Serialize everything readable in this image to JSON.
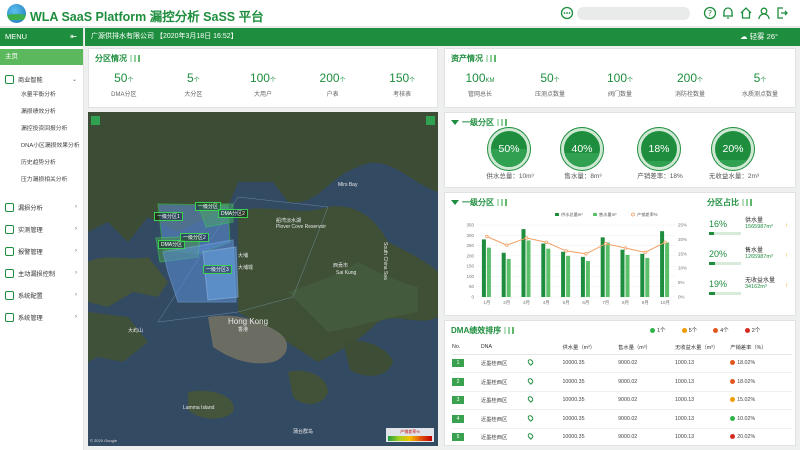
{
  "app": {
    "title": "WLA SaaS Platform 漏控分析 SaSS 平台"
  },
  "sidebar": {
    "menu_label": "MENU",
    "home": "主页",
    "groups": [
      {
        "label": "商业智能",
        "expanded": true,
        "items": [
          "水量平衡分析",
          "漏损绩效分析",
          "漏控投资回报分析",
          "DNA小区漏损效果分析",
          "历史趋势分析",
          "压力漏损相关分析"
        ]
      },
      {
        "label": "漏损分析"
      },
      {
        "label": "实测管理"
      },
      {
        "label": "报警管理"
      },
      {
        "label": "主动漏损控制"
      },
      {
        "label": "系统配置"
      },
      {
        "label": "系统管理"
      }
    ]
  },
  "company_bar": {
    "company": "广源供排水有限公司",
    "datetime": "2020年3月18日 16:52",
    "weather": "轻雾 26°"
  },
  "partition": {
    "title": "分区情况",
    "stats": [
      {
        "value": "50",
        "unit": "个",
        "label": "DMA分区"
      },
      {
        "value": "5",
        "unit": "个",
        "label": "大分区"
      },
      {
        "value": "100",
        "unit": "个",
        "label": "大用户"
      },
      {
        "value": "200",
        "unit": "个",
        "label": "户表"
      },
      {
        "value": "150",
        "unit": "个",
        "label": "考核表"
      }
    ]
  },
  "assets": {
    "title": "资产情况",
    "stats": [
      {
        "value": "100",
        "unit": "KM",
        "label": "管网总长"
      },
      {
        "value": "50",
        "unit": "个",
        "label": "压测点数量"
      },
      {
        "value": "100",
        "unit": "个",
        "label": "阀门数量"
      },
      {
        "value": "200",
        "unit": "个",
        "label": "消防栓数量"
      },
      {
        "value": "5",
        "unit": "个",
        "label": "水质测点数量"
      }
    ]
  },
  "map": {
    "labels": [
      {
        "text": "一级分区1"
      },
      {
        "text": "一级分区"
      },
      {
        "text": "DMA分区"
      },
      {
        "text": "DMA分区2"
      },
      {
        "text": "一级分区2"
      },
      {
        "text": "大埔"
      },
      {
        "text": "一级分区3"
      },
      {
        "text": "大埔墟"
      },
      {
        "text": "Mirs Bay"
      },
      {
        "text": "船湾淡水湖"
      },
      {
        "text": "Plover Cove Reservoir"
      },
      {
        "text": "西贡市"
      },
      {
        "text": "Sai Kung"
      },
      {
        "text": "Hong Kong"
      },
      {
        "text": "香港"
      },
      {
        "text": "South China Sea"
      },
      {
        "text": "Lamma Island"
      },
      {
        "text": "蒲台群岛"
      },
      {
        "text": "大屿山"
      }
    ],
    "legend_title": "产销差率%",
    "copyright": "© 2020 Google"
  },
  "level1": {
    "title": "一级分区",
    "gauges": [
      {
        "percent": 50,
        "label": "50%",
        "caption": "供水总量：10m³"
      },
      {
        "percent": 40,
        "label": "40%",
        "caption": "售水量：8m³"
      },
      {
        "percent": 18,
        "label": "18%",
        "caption": "产销差率：18%"
      },
      {
        "percent": 20,
        "label": "20%",
        "caption": "无收益水量：2m³"
      }
    ]
  },
  "level1_chart": {
    "title": "一级分区",
    "chart_data": {
      "type": "bar",
      "categories": [
        "1月",
        "2月",
        "3月",
        "4月",
        "5月",
        "6月",
        "7月",
        "8月",
        "9月",
        "10月"
      ],
      "legend": [
        "供水总量m³",
        "售水量m³",
        "产销差率%"
      ],
      "series": [
        {
          "name": "供水总量m³",
          "values": [
            280,
            215,
            330,
            260,
            220,
            195,
            290,
            230,
            210,
            320
          ]
        },
        {
          "name": "售水量m³",
          "values": [
            240,
            185,
            275,
            235,
            200,
            175,
            265,
            205,
            190,
            265
          ]
        },
        {
          "name": "产销差率%",
          "values": [
            21,
            18,
            20.5,
            19,
            16,
            15,
            18.5,
            17,
            15.5,
            19
          ]
        }
      ],
      "y_left_ticks": [
        "0",
        "50",
        "100",
        "150",
        "200",
        "250",
        "300",
        "350"
      ],
      "y_right_ticks": [
        "0%",
        "5%",
        "10%",
        "15%",
        "20%",
        "25%"
      ],
      "ylim_left": [
        0,
        350
      ],
      "ylim_right": [
        0,
        25
      ]
    }
  },
  "ratio": {
    "title": "分区占比",
    "items": [
      {
        "percent": "16%",
        "label": "供水量",
        "value": "1565987m³",
        "fill": 16
      },
      {
        "percent": "20%",
        "label": "售水量",
        "value": "1265987m³",
        "fill": 20
      },
      {
        "percent": "19%",
        "label": "无收益水量",
        "value": "34162m³",
        "fill": 19
      }
    ]
  },
  "dma": {
    "title": "DMA绩效排序",
    "legend": [
      {
        "label": "1个",
        "color": "#2fb34a"
      },
      {
        "label": "5个",
        "color": "#f29b00"
      },
      {
        "label": "4个",
        "color": "#e2551f"
      },
      {
        "label": "2个",
        "color": "#d62b1f"
      }
    ],
    "headers": [
      "No.",
      "DNA",
      "",
      "供水量（m³）",
      "售水量（m³）",
      "无收益水量（m³）",
      "产销差率（%）"
    ],
    "rows": [
      {
        "no": "1",
        "dna": "近墨桂西区",
        "supply": "10000.35",
        "sale": "9000.02",
        "loss": "1000.13",
        "rate": "18.02%",
        "color": "#e2551f"
      },
      {
        "no": "2",
        "dna": "近墨桂西区",
        "supply": "10000.35",
        "sale": "9000.02",
        "loss": "1000.13",
        "rate": "18.02%",
        "color": "#e2551f"
      },
      {
        "no": "3",
        "dna": "近墨桂西区",
        "supply": "10000.35",
        "sale": "9000.02",
        "loss": "1000.13",
        "rate": "15.02%",
        "color": "#f29b00"
      },
      {
        "no": "4",
        "dna": "近墨桂西区",
        "supply": "10000.35",
        "sale": "9000.02",
        "loss": "1000.13",
        "rate": "10.02%",
        "color": "#2fb34a"
      },
      {
        "no": "5",
        "dna": "近墨桂西区",
        "supply": "10000.35",
        "sale": "9000.02",
        "loss": "1000.13",
        "rate": "20.02%",
        "color": "#d62b1f"
      }
    ]
  }
}
